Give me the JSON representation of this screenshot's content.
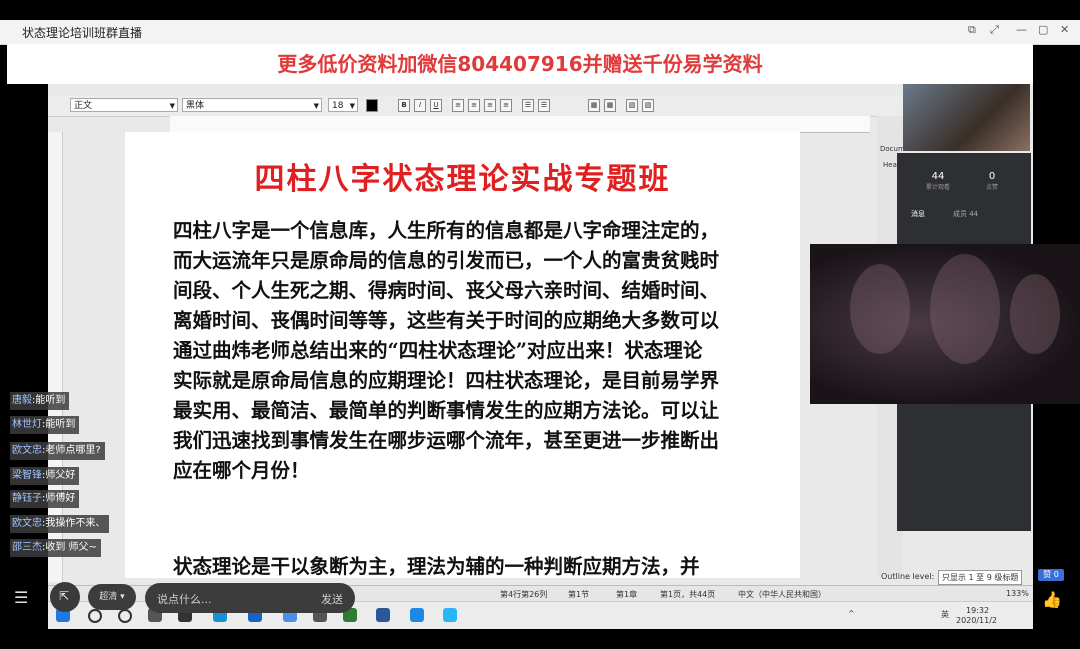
{
  "window": {
    "title": "状态理论培训班群直播"
  },
  "promo_banner": "更多低价资料加微信804407916并赠送千份易学资料",
  "toolbar": {
    "style_value": "正文",
    "font_value": "黑体",
    "size_value": "18"
  },
  "document": {
    "heading": "四柱八字状态理论实战专题班",
    "lines": [
      "四柱八字是一个信息库，人生所有的信息都是八字命理注定的，",
      "而大运流年只是原命局的信息的引发而已，一个人的富贵贫贱时",
      "间段、个人生死之期、得病时间、丧父母六亲时间、结婚时间、",
      "离婚时间、丧偶时间等等，这些有关于时间的应期绝大多数可以",
      "通过曲炜老师总结出来的“四柱状态理论”对应出来！状态理论",
      "实际就是原命局信息的应期理论！四柱状态理论，是目前易学界",
      "最实用、最简洁、最简单的判断事情发生的应期方法论。可以让",
      "我们迅速找到事情发生在哪步运哪个流年，甚至更进一步推断出",
      "应在哪个月份！"
    ],
    "next_line": "状态理论是干以象断为主，理法为辅的一种判断应期方法，并"
  },
  "side_panel": {
    "doc_label": "Docum",
    "head_label": "Hea"
  },
  "stats": {
    "viewers": "44",
    "viewers_label": "累计观看",
    "likes": "0",
    "likes_label": "点赞"
  },
  "chat_tabs": {
    "tab1": "消息",
    "tab2": "成员 44"
  },
  "chat": [
    {
      "user": "唐毅",
      "msg": "能听到"
    },
    {
      "user": "林世灯",
      "msg": "能听到"
    },
    {
      "user": "欧文忠",
      "msg": "老师点哪里?"
    },
    {
      "user": "梁智锋",
      "msg": "师父好"
    },
    {
      "user": "静钰子",
      "msg": "师傅好"
    },
    {
      "user": "欧文忠",
      "msg": "我操作不来、"
    },
    {
      "user": "邵三杰",
      "msg": "收到 师父~"
    }
  ],
  "bottom": {
    "quality": "超清",
    "input_placeholder": "说点什么...",
    "send": "发送"
  },
  "like_badge": "赞 0",
  "statusbar": {
    "page_info": "第4行第26列",
    "section": "第1节",
    "chapter": "第1章",
    "pages": "第1页，共44页",
    "lang": "中文（中华人民共和国）",
    "outline_label": "Outline level:",
    "outline_value": "只显示 1 至 9 级标题",
    "zoom": "133%"
  },
  "taskbar": {
    "ime": "英",
    "time": "19:32",
    "date": "2020/11/2"
  },
  "colors": {
    "heading_red": "#e02020",
    "promo_red": "#e03a3a"
  }
}
